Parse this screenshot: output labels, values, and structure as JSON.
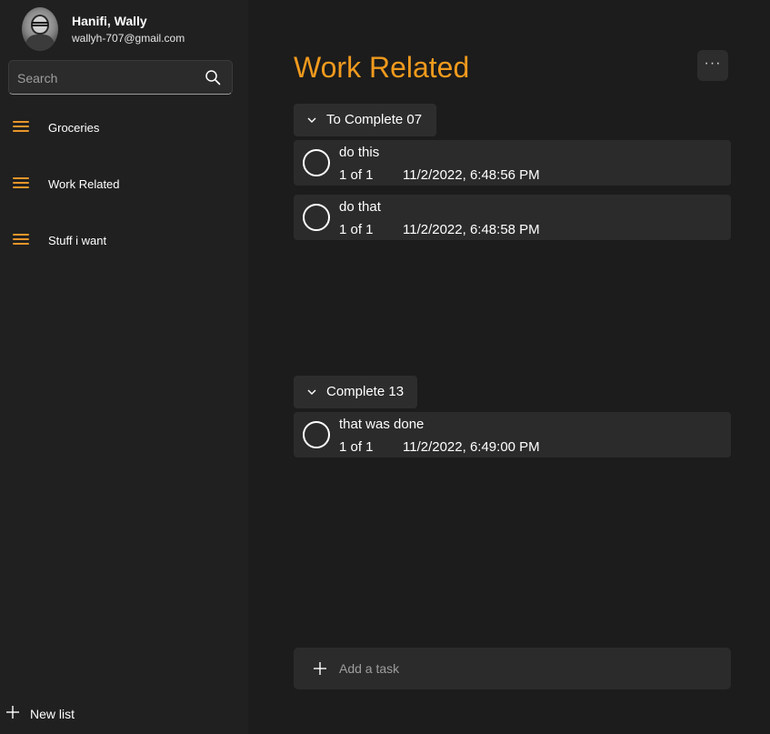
{
  "profile": {
    "name": "Hanifi, Wally",
    "email": "wallyh-707@gmail.com"
  },
  "search": {
    "placeholder": "Search",
    "value": ""
  },
  "sidebar": {
    "lists": [
      {
        "label": "Groceries",
        "icon": "hamburger-icon"
      },
      {
        "label": "Work Related",
        "icon": "hamburger-icon"
      },
      {
        "label": "Stuff i want",
        "icon": "hamburger-icon"
      }
    ],
    "new_list_label": "New list"
  },
  "main": {
    "title": "Work Related",
    "more_label": "···",
    "groups": [
      {
        "label": "To Complete 07",
        "tasks": [
          {
            "title": "do this",
            "count": "1 of 1",
            "date": "11/2/2022, 6:48:56 PM"
          },
          {
            "title": "do that",
            "count": "1 of 1",
            "date": "11/2/2022, 6:48:58 PM"
          }
        ]
      },
      {
        "label": "Complete 13",
        "tasks": [
          {
            "title": "that was done",
            "count": "1 of 1",
            "date": "11/2/2022, 6:49:00 PM"
          }
        ]
      }
    ],
    "add_task_placeholder": "Add a task"
  },
  "colors": {
    "accent": "#f09a1d",
    "sidebar_bg": "#202020",
    "main_bg": "#1c1c1c",
    "card_bg": "#2b2b2b"
  }
}
